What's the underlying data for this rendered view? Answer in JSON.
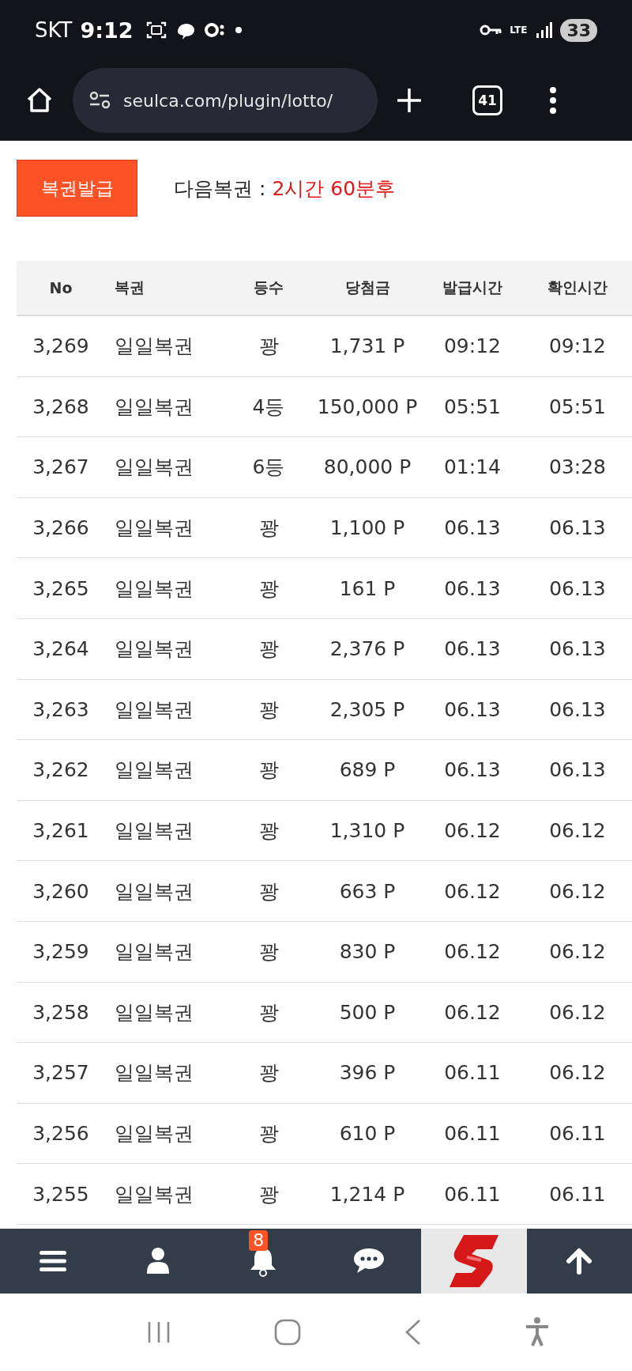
{
  "status_bar": {
    "carrier": "SKT",
    "time": "9:12",
    "network": "LTE",
    "battery": "33"
  },
  "browser": {
    "url": "seulca.com/plugin/lotto/",
    "tab_count": "41"
  },
  "issue_button": "복권발급",
  "next_ticket": {
    "label": "다음복권",
    "separator": ":",
    "value": "2시간 60분후"
  },
  "table": {
    "columns": [
      "No",
      "복권",
      "등수",
      "당첨금",
      "발급시간",
      "확인시간"
    ],
    "rows": [
      [
        "3,269",
        "일일복권",
        "꽝",
        "1,731 P",
        "09:12",
        "09:12"
      ],
      [
        "3,268",
        "일일복권",
        "4등",
        "150,000 P",
        "05:51",
        "05:51"
      ],
      [
        "3,267",
        "일일복권",
        "6등",
        "80,000 P",
        "01:14",
        "03:28"
      ],
      [
        "3,266",
        "일일복권",
        "꽝",
        "1,100 P",
        "06.13",
        "06.13"
      ],
      [
        "3,265",
        "일일복권",
        "꽝",
        "161 P",
        "06.13",
        "06.13"
      ],
      [
        "3,264",
        "일일복권",
        "꽝",
        "2,376 P",
        "06.13",
        "06.13"
      ],
      [
        "3,263",
        "일일복권",
        "꽝",
        "2,305 P",
        "06.13",
        "06.13"
      ],
      [
        "3,262",
        "일일복권",
        "꽝",
        "689 P",
        "06.13",
        "06.13"
      ],
      [
        "3,261",
        "일일복권",
        "꽝",
        "1,310 P",
        "06.12",
        "06.12"
      ],
      [
        "3,260",
        "일일복권",
        "꽝",
        "663 P",
        "06.12",
        "06.12"
      ],
      [
        "3,259",
        "일일복권",
        "꽝",
        "830 P",
        "06.12",
        "06.12"
      ],
      [
        "3,258",
        "일일복권",
        "꽝",
        "500 P",
        "06.12",
        "06.12"
      ],
      [
        "3,257",
        "일일복권",
        "꽝",
        "396 P",
        "06.11",
        "06.12"
      ],
      [
        "3,256",
        "일일복권",
        "꽝",
        "610 P",
        "06.11",
        "06.11"
      ],
      [
        "3,255",
        "일일복권",
        "꽝",
        "1,214 P",
        "06.11",
        "06.11"
      ]
    ]
  },
  "bottom_nav": {
    "notification_count": "8"
  }
}
